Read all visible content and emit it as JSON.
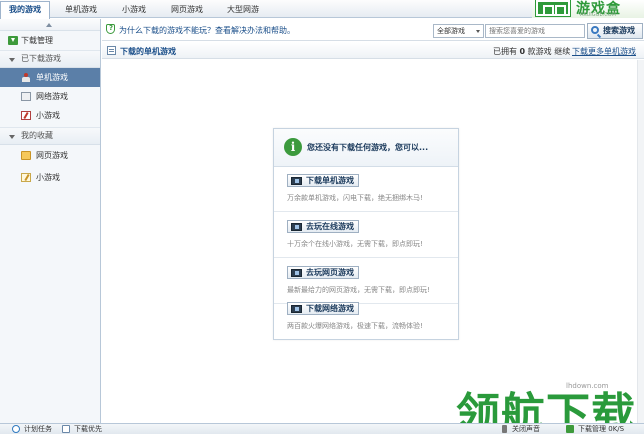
{
  "tabs": [
    {
      "label": "我的游戏",
      "active": true
    },
    {
      "label": "单机游戏",
      "active": false
    },
    {
      "label": "小游戏",
      "active": false
    },
    {
      "label": "网页游戏",
      "active": false
    },
    {
      "label": "大型网游",
      "active": false
    }
  ],
  "logo": {
    "text": "游戏盒",
    "sub": "AKUIGGE.COM"
  },
  "sidebar": {
    "download_manage": "下载管理",
    "downloaded_group": "已下载游戏",
    "downloaded_items": [
      {
        "label": "单机游戏",
        "active": true
      },
      {
        "label": "网络游戏",
        "active": false
      },
      {
        "label": "小游戏",
        "active": false
      }
    ],
    "favorites_group": "我的收藏",
    "favorite_items": [
      {
        "label": "网页游戏"
      },
      {
        "label": "小游戏"
      }
    ]
  },
  "toolbar": {
    "notice": "为什么下载的游戏不能玩？查看解决办法和帮助。",
    "category_select": "全部游戏",
    "search_placeholder": "搜索您喜爱的游戏",
    "search_button": "搜索游戏"
  },
  "list": {
    "title": "下载的单机游戏",
    "count_prefix": "已拥有",
    "count": "0",
    "count_suffix": "款游戏",
    "continue_label": "继续",
    "more_link": "下载更多单机游戏"
  },
  "empty_panel": {
    "title": "您还没有下载任何游戏，您可以...",
    "options": [
      {
        "button": "下载单机游戏",
        "desc": "万余款单机游戏，闪电下载，绝无捆绑木马!"
      },
      {
        "button": "去玩在线游戏",
        "desc": "十万余个在线小游戏，无需下载，即点即玩!"
      },
      {
        "button": "去玩网页游戏",
        "desc": "最新最给力的网页游戏，无需下载，即点即玩!"
      },
      {
        "button": "下载网络游戏",
        "desc": "两百款火爆网络游戏，极速下载，流畅体验!"
      }
    ]
  },
  "statusbar": {
    "plan_task": "计划任务",
    "download_first": "下载优先",
    "sound": "关闭声音",
    "download_manage": "下载管理",
    "speed": "0K/S"
  },
  "watermark": {
    "small": "lhdown.com",
    "big": "领航下载"
  },
  "colors": {
    "accent_blue": "#1b4f8a",
    "brand_green": "#2f9a3a",
    "selected_bg": "#5b7fa8"
  }
}
